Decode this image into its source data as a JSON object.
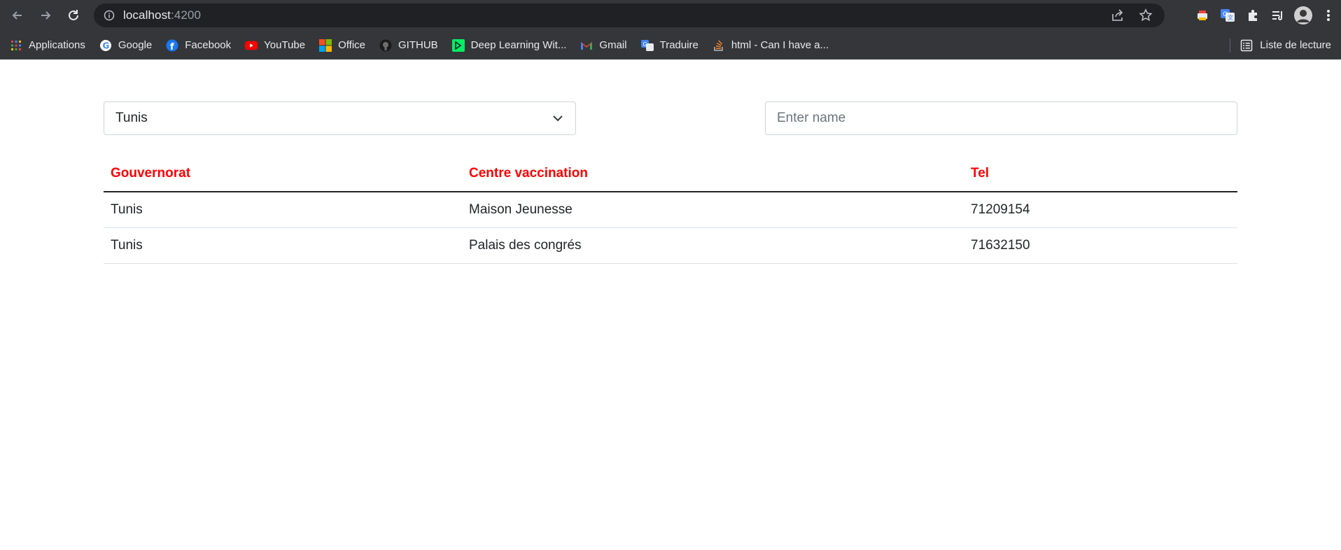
{
  "browser": {
    "url_host": "localhost",
    "url_port": ":4200"
  },
  "bookmarks": [
    {
      "label": "Applications",
      "icon": "apps-grid-icon"
    },
    {
      "label": "Google",
      "icon": "google-icon"
    },
    {
      "label": "Facebook",
      "icon": "facebook-icon"
    },
    {
      "label": "YouTube",
      "icon": "youtube-icon"
    },
    {
      "label": "Office",
      "icon": "office-icon"
    },
    {
      "label": "GITHUB",
      "icon": "github-icon"
    },
    {
      "label": "Deep Learning Wit...",
      "icon": "datacamp-icon"
    },
    {
      "label": "Gmail",
      "icon": "gmail-icon"
    },
    {
      "label": "Traduire",
      "icon": "translate-icon"
    },
    {
      "label": "html - Can I have a...",
      "icon": "stackoverflow-icon"
    }
  ],
  "reading_list": "Liste de lecture",
  "filter": {
    "selected_governorate": "Tunis",
    "name_placeholder": "Enter name",
    "name_value": ""
  },
  "table": {
    "headers": [
      "Gouvernorat",
      "Centre vaccination",
      "Tel"
    ],
    "rows": [
      [
        "Tunis",
        "Maison Jeunesse",
        "71209154"
      ],
      [
        "Tunis",
        "Palais des congrés",
        "71632150"
      ]
    ]
  },
  "colors": {
    "header_text": "#ff0000",
    "chrome_bg": "#35363a",
    "omnibox_bg": "#202124"
  }
}
